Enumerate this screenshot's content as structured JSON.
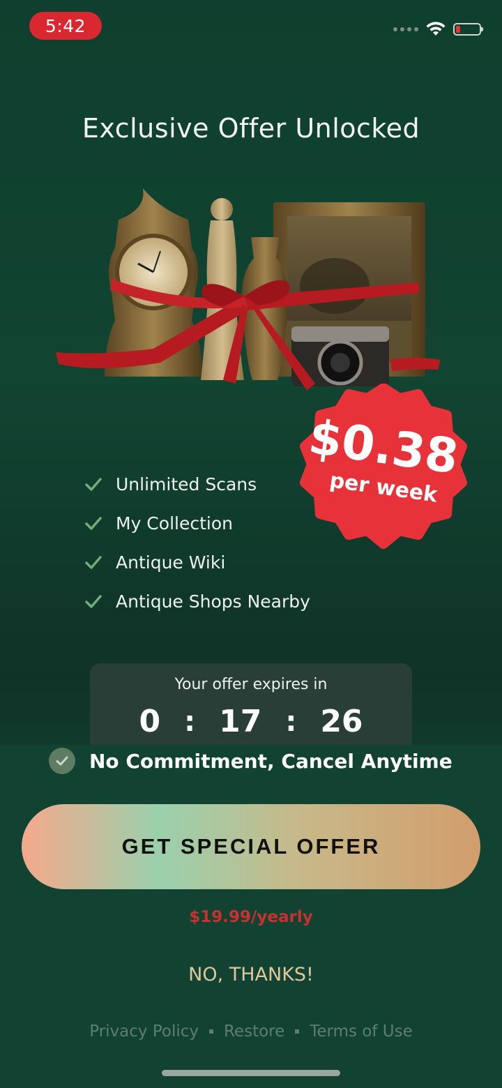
{
  "status_bar": {
    "time": "5:42",
    "icons": [
      "signal-dots-icon",
      "wifi-icon",
      "battery-low-icon"
    ],
    "battery_color": "#e8333a"
  },
  "title": "Exclusive Offer Unlocked",
  "hero_image": {
    "icon": "antiques-gift-illustration"
  },
  "badge": {
    "price": "$0.38",
    "period": "per week",
    "color": "#e8323a"
  },
  "features": [
    {
      "label": "Unlimited Scans",
      "icon": "check-icon"
    },
    {
      "label": "My Collection",
      "icon": "check-icon"
    },
    {
      "label": "Antique Wiki",
      "icon": "check-icon"
    },
    {
      "label": "Antique Shops Nearby",
      "icon": "check-icon"
    }
  ],
  "timer": {
    "label": "Your offer expires in",
    "hours": "0",
    "minutes": "17",
    "seconds": "26",
    "separator": ":"
  },
  "commitment": {
    "text": "No Commitment, Cancel Anytime",
    "icon": "check-circle-icon"
  },
  "cta": {
    "label": "GET SPECIAL OFFER"
  },
  "yearly_price": "$19.99/yearly",
  "no_thanks": "NO, THANKS!",
  "footer": {
    "privacy": "Privacy Policy",
    "restore": "Restore",
    "terms": "Terms of Use"
  },
  "colors": {
    "background": "#114232",
    "accent_red": "#c8312f",
    "no_thanks": "#e0c79b"
  }
}
